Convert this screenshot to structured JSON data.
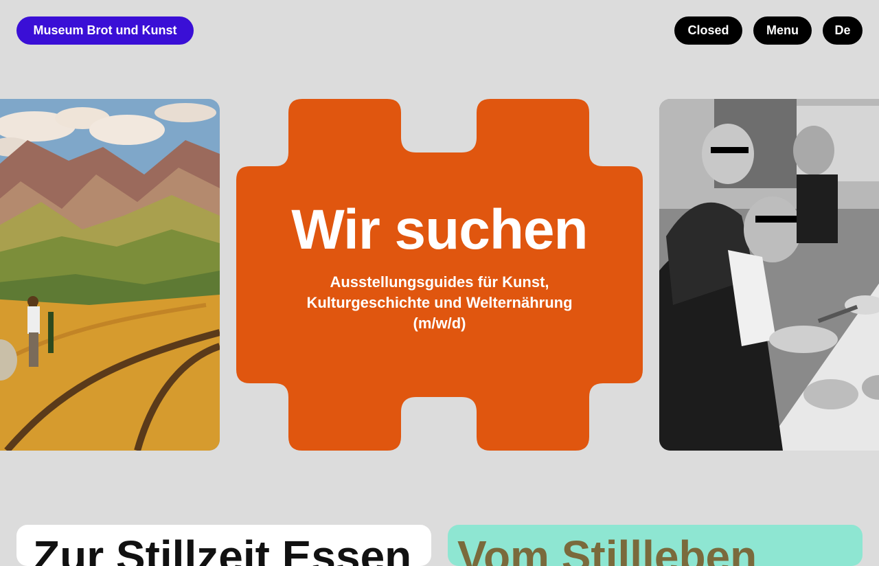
{
  "header": {
    "logo_label": "Museum Brot und Kunst",
    "buttons": {
      "closed": "Closed",
      "menu": "Menu",
      "language": "De"
    }
  },
  "hero": {
    "title": "Wir suchen",
    "subtitle_lines": [
      "Ausstellungsguides für Kunst,",
      "Kulturgeschichte und Welternährung",
      "(m/w/d)"
    ],
    "left_image": "landscape-painting-farmer-fields-mountains",
    "right_image": "black-white-photo-men-dining-table",
    "accent_color": "#e0560f"
  },
  "cards": {
    "left_title": "Zur Stillzeit Essen",
    "right_title": "Vom Stillleben"
  },
  "colors": {
    "background": "#dcdcdc",
    "logo": "#3a0fd6",
    "buttons": "#000000",
    "teal_card": "#8ee6d2"
  }
}
